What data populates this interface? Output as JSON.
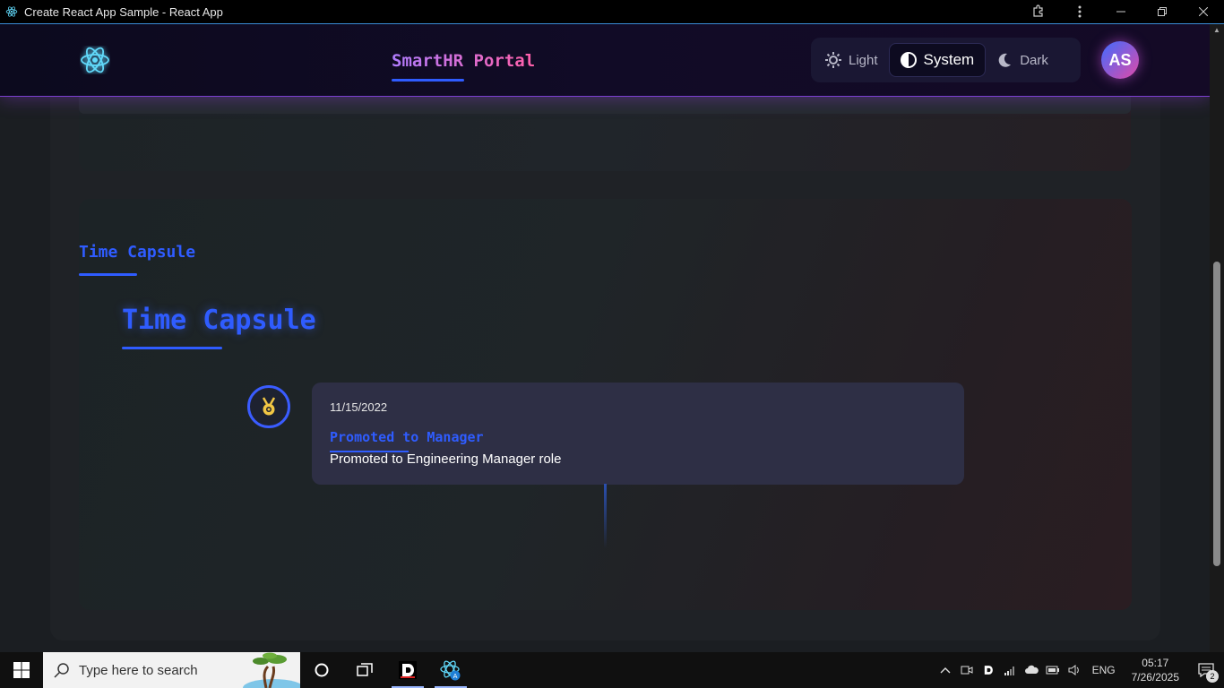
{
  "window": {
    "title": "Create React App Sample - React App"
  },
  "navbar": {
    "brand": "SmartHR Portal",
    "theme_options": [
      {
        "label": "Light",
        "icon": "sun-icon",
        "active": false
      },
      {
        "label": "System",
        "icon": "half-circle-icon",
        "active": true
      },
      {
        "label": "Dark",
        "icon": "moon-icon",
        "active": false
      }
    ],
    "avatar_initials": "AS"
  },
  "time_capsule": {
    "section_title": "Time Capsule",
    "heading": "Time Capsule",
    "events": [
      {
        "date": "11/15/2022",
        "title": "Promoted to Manager",
        "description": "Promoted to Engineering Manager role",
        "icon": "medal-icon"
      }
    ]
  },
  "taskbar": {
    "search_placeholder": "Type here to search",
    "language": "ENG",
    "time": "05:17",
    "date": "7/26/2025",
    "notification_count": "2"
  },
  "colors": {
    "accent": "#2f5cff",
    "navbar_border": "#7b3fd0",
    "event_card": "#2e2f45"
  }
}
